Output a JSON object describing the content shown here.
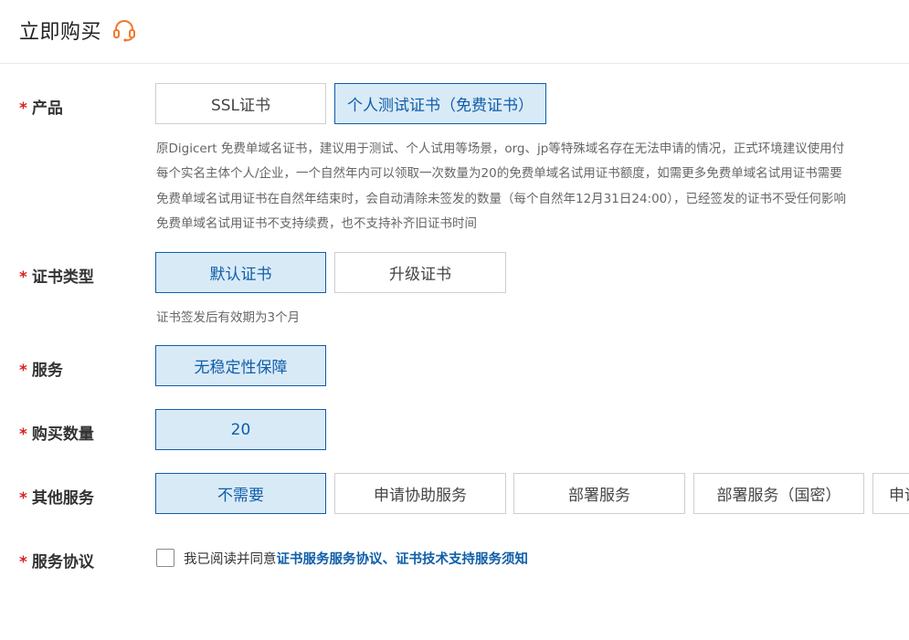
{
  "header": {
    "title": "立即购买",
    "support_icon": "headset-icon"
  },
  "product": {
    "label": "产品",
    "options": [
      {
        "label": "SSL证书",
        "selected": false
      },
      {
        "label": "个人测试证书（免费证书）",
        "selected": true
      }
    ],
    "description": [
      "原Digicert 免费单域名证书，建议用于测试、个人试用等场景，org、jp等特殊域名存在无法申请的情况，正式环境建议使用付",
      "每个实名主体个人/企业，一个自然年内可以领取一次数量为20的免费单域名试用证书额度，如需更多免费单域名试用证书需要",
      "免费单域名试用证书在自然年结束时，会自动清除未签发的数量（每个自然年12月31日24:00），已经签发的证书不受任何影响",
      "免费单域名试用证书不支持续费，也不支持补齐旧证书时间"
    ]
  },
  "cert_type": {
    "label": "证书类型",
    "options": [
      {
        "label": "默认证书",
        "selected": true
      },
      {
        "label": "升级证书",
        "selected": false
      }
    ],
    "note": "证书签发后有效期为3个月"
  },
  "service": {
    "label": "服务",
    "options": [
      {
        "label": "无稳定性保障",
        "selected": true
      }
    ]
  },
  "quantity": {
    "label": "购买数量",
    "options": [
      {
        "label": "20",
        "selected": true
      }
    ]
  },
  "other_services": {
    "label": "其他服务",
    "options": [
      {
        "label": "不需要",
        "selected": true
      },
      {
        "label": "申请协助服务",
        "selected": false
      },
      {
        "label": "部署服务",
        "selected": false
      },
      {
        "label": "部署服务（国密）",
        "selected": false
      },
      {
        "label": "申请",
        "selected": false
      }
    ]
  },
  "agreement": {
    "label": "服务协议",
    "prefix": "我已阅读并同意",
    "link1": "证书服务服务协议",
    "separator": "、",
    "link2": "证书技术支持服务须知"
  },
  "colors": {
    "accent": "#0f5ea8",
    "selected_bg": "#d9eaf7",
    "required": "#d9221c",
    "icon": "#f0782d"
  }
}
